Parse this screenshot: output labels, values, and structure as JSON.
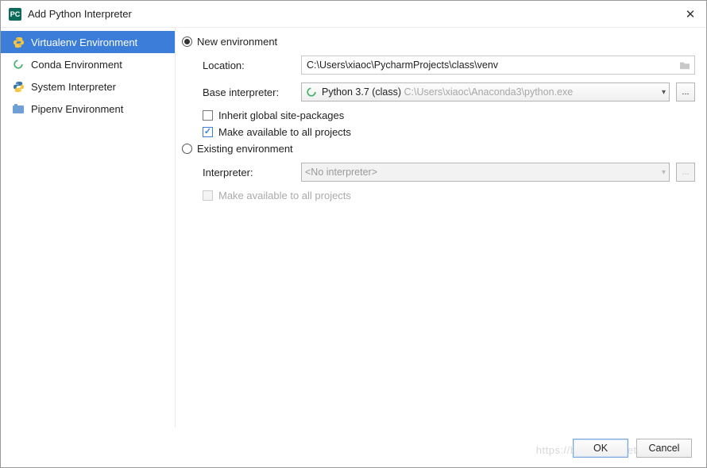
{
  "window": {
    "title": "Add Python Interpreter"
  },
  "sidebar": {
    "items": [
      {
        "label": "Virtualenv Environment"
      },
      {
        "label": "Conda Environment"
      },
      {
        "label": "System Interpreter"
      },
      {
        "label": "Pipenv Environment"
      }
    ]
  },
  "radiogroup": {
    "new_env_label": "New environment",
    "existing_env_label": "Existing environment",
    "selected": "new"
  },
  "new_env": {
    "location_label": "Location:",
    "location_value": "C:\\Users\\xiaoc\\PycharmProjects\\class\\venv",
    "base_interp_label": "Base interpreter:",
    "base_interp_name": "Python 3.7 (class)",
    "base_interp_path": "C:\\Users\\xiaoc\\Anaconda3\\python.exe",
    "inherit_label": "Inherit global site-packages",
    "inherit_checked": false,
    "avail_label": "Make available to all projects",
    "avail_checked": true
  },
  "existing_env": {
    "interp_label": "Interpreter:",
    "interp_value": "<No interpreter>",
    "avail_label": "Make available to all projects",
    "avail_checked": false,
    "enabled": false
  },
  "buttons": {
    "ok": "OK",
    "cancel": "Cancel"
  },
  "watermark": "https://blog.csdn.net/qq_3..."
}
